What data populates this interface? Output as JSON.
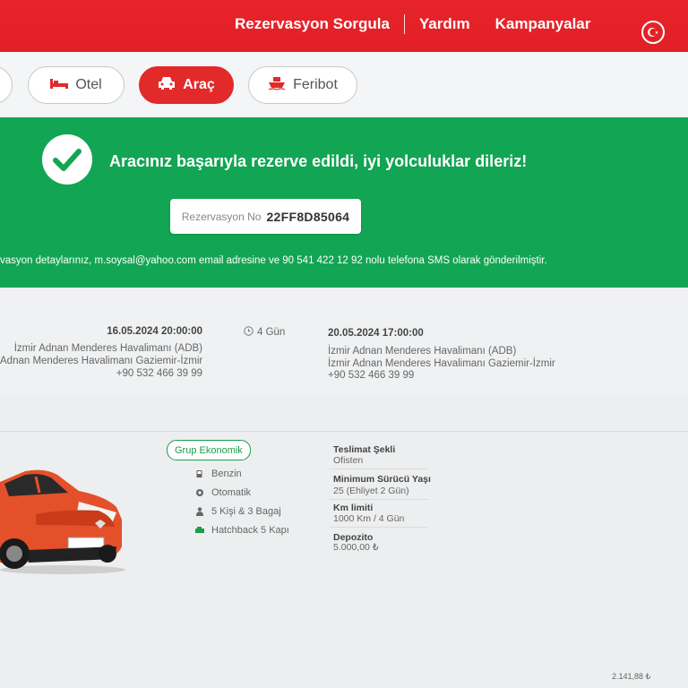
{
  "header": {
    "nav": [
      "Rezervasyon Sorgula",
      "Yardım",
      "Kampanyalar"
    ],
    "flag_icon": "turkey-flag-icon"
  },
  "tabs": [
    {
      "label": "Otel",
      "icon": "bed-icon",
      "active": false
    },
    {
      "label": "Araç",
      "icon": "car-icon",
      "active": true
    },
    {
      "label": "Feribot",
      "icon": "ferry-icon",
      "active": false
    }
  ],
  "success": {
    "message": "Aracınız başarıyla rezerve edildi, iyi yolculuklar dileriz!",
    "reservation_label": "Rezervasyon No",
    "reservation_no": "22FF8D85064",
    "notice": "vasyon detaylarınız, m.soysal@yahoo.com email adresine ve 90 541 422 12 92 nolu telefona SMS olarak gönderilmiştir."
  },
  "pickup": {
    "datetime": "16.05.2024 20:00:00",
    "location": "İzmir Adnan Menderes Havalimanı (ADB)",
    "address": "Adnan Menderes Havalimanı Gaziemir-İzmir",
    "phone": "+90 532 466 39 99"
  },
  "duration": "4 Gün",
  "dropoff": {
    "datetime": "20.05.2024 17:00:00",
    "location": "İzmir Adnan Menderes Havalimanı (ADB)",
    "address": "İzmir Adnan Menderes Havalimanı Gaziemir-İzmir",
    "phone": "+90 532 466 39 99"
  },
  "car": {
    "group": "Grup Ekonomik",
    "features": [
      "Benzin",
      "Otomatik",
      "5 Kişi & 3 Bagaj",
      "Hatchback 5 Kapı"
    ],
    "specs": [
      {
        "label": "Teslimat Şekli",
        "value": "Ofisten"
      },
      {
        "label": "Minimum Sürücü Yaşı",
        "value": "25 (Ehliyet 2 Gün)"
      },
      {
        "label": "Km limiti",
        "value": "1000 Km / 4 Gün"
      },
      {
        "label": "Depozito",
        "value": "5.000,00 ₺"
      }
    ],
    "color": "#e4502a"
  },
  "price": "2.141,88 ₺"
}
